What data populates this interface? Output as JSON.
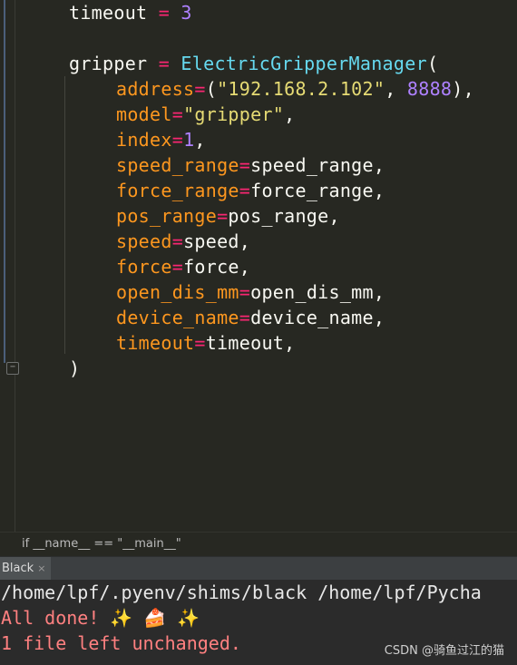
{
  "editor": {
    "lines": [
      {
        "parts": [
          [
            "var",
            "timeout"
          ],
          [
            "var",
            " "
          ],
          [
            "op",
            "="
          ],
          [
            "var",
            " "
          ],
          [
            "num",
            "3"
          ]
        ]
      },
      {
        "parts": []
      },
      {
        "parts": [
          [
            "var",
            "gripper"
          ],
          [
            "var",
            " "
          ],
          [
            "op",
            "="
          ],
          [
            "var",
            " "
          ],
          [
            "cls",
            "ElectricGripperManager"
          ],
          [
            "var",
            "("
          ]
        ]
      },
      {
        "indent": true,
        "parts": [
          [
            "kw",
            "address"
          ],
          [
            "op",
            "="
          ],
          [
            "var",
            "("
          ],
          [
            "str",
            "\"192.168.2.102\""
          ],
          [
            "var",
            ", "
          ],
          [
            "num",
            "8888"
          ],
          [
            "var",
            "),"
          ]
        ]
      },
      {
        "indent": true,
        "parts": [
          [
            "kw",
            "model"
          ],
          [
            "op",
            "="
          ],
          [
            "str",
            "\"gripper\""
          ],
          [
            "var",
            ","
          ]
        ]
      },
      {
        "indent": true,
        "parts": [
          [
            "kw",
            "index"
          ],
          [
            "op",
            "="
          ],
          [
            "num",
            "1"
          ],
          [
            "var",
            ","
          ]
        ]
      },
      {
        "indent": true,
        "parts": [
          [
            "kw",
            "speed_range"
          ],
          [
            "op",
            "="
          ],
          [
            "var",
            "speed_range,"
          ]
        ]
      },
      {
        "indent": true,
        "parts": [
          [
            "kw",
            "force_range"
          ],
          [
            "op",
            "="
          ],
          [
            "var",
            "force_range,"
          ]
        ]
      },
      {
        "indent": true,
        "parts": [
          [
            "kw",
            "pos_range"
          ],
          [
            "op",
            "="
          ],
          [
            "var",
            "pos_range,"
          ]
        ]
      },
      {
        "indent": true,
        "parts": [
          [
            "kw",
            "speed"
          ],
          [
            "op",
            "="
          ],
          [
            "var",
            "speed,"
          ]
        ]
      },
      {
        "indent": true,
        "parts": [
          [
            "kw",
            "force"
          ],
          [
            "op",
            "="
          ],
          [
            "var",
            "force,"
          ]
        ]
      },
      {
        "indent": true,
        "parts": [
          [
            "kw",
            "open_dis_mm"
          ],
          [
            "op",
            "="
          ],
          [
            "var",
            "open_dis_mm,"
          ]
        ]
      },
      {
        "indent": true,
        "parts": [
          [
            "kw",
            "device_name"
          ],
          [
            "op",
            "="
          ],
          [
            "var",
            "device_name,"
          ]
        ]
      },
      {
        "indent": true,
        "parts": [
          [
            "kw",
            "timeout"
          ],
          [
            "op",
            "="
          ],
          [
            "var",
            "timeout,"
          ]
        ]
      },
      {
        "parts": [
          [
            "var",
            ")"
          ]
        ]
      }
    ]
  },
  "breadcrumb": {
    "text": "if __name__ == \"__main__\""
  },
  "run_tab": {
    "label": "Black",
    "close_glyph": "×"
  },
  "console": {
    "command": "/home/lpf/.pyenv/shims/black /home/lpf/Pycha",
    "done": "All done! ✨ 🍰 ✨",
    "result": "1 file left unchanged."
  },
  "watermark": "CSDN @骑鱼过江的猫",
  "colors": {
    "keyword_arg": "#fd971f",
    "operator": "#f92672",
    "number": "#ae81ff",
    "string": "#e6db74",
    "class_name": "#66d9ef",
    "console_error": "#ff8080"
  }
}
